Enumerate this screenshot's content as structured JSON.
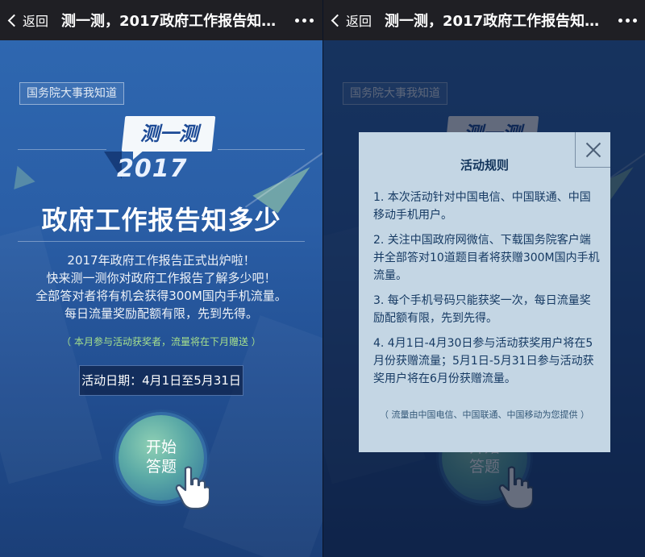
{
  "nav": {
    "back_label": "返回",
    "title": "测一测，2017政府工作报告知多少"
  },
  "page": {
    "tag": "国务院大事我知道",
    "logo_bubble": "测一测",
    "logo_year": "2017",
    "main_title": "政府工作报告知多少",
    "desc_lines": [
      "2017年政府工作报告正式出炉啦！",
      "快来测一测你对政府工作报告了解多少吧！",
      "全部答对者将有机会获得300M国内手机流量。",
      "每日流量奖励配额有限，先到先得。"
    ],
    "note": "（ 本月参与活动获奖者，流量将在下月赠送 ）",
    "date_badge": "活动日期：4月1日至5月31日",
    "start_button": [
      "开始",
      "答题"
    ]
  },
  "modal": {
    "title": "活动规则",
    "rules": [
      "1. 本次活动针对中国电信、中国联通、中国移动手机用户。",
      "2. 关注中国政府网微信、下载国务院客户端并全部答对10道题目者将获赠300M国内手机流量。",
      "3. 每个手机号码只能获奖一次，每日流量奖励配额有限，先到先得。",
      "4. 4月1日-4月30日参与活动获奖用户将在5月份获赠流量；5月1日-5月31日参与活动获奖用户将在6月份获赠流量。"
    ],
    "footer": "（ 流量由中国电信、中国联通、中国移动为您提供 ）"
  },
  "colors": {
    "navbar": "#1f1f24",
    "bg_top": "#2e67b0",
    "accent_green": "#a6e08d",
    "modal_bg": "#c4d6e4"
  },
  "icons": {
    "back": "chevron-left-icon",
    "more": "more-dots-icon",
    "close": "close-icon",
    "hand": "pointer-hand-icon"
  }
}
